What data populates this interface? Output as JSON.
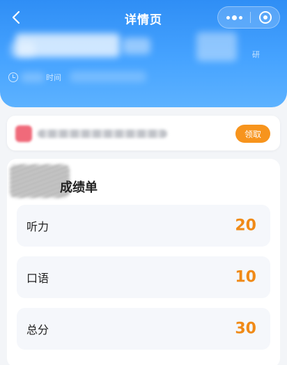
{
  "header": {
    "title": "详情页",
    "time_label": "时间",
    "small_tag": "研"
  },
  "coupon": {
    "claim_label": "领取"
  },
  "score_card": {
    "title": "成绩单",
    "rows": [
      {
        "label": "听力",
        "value": "20"
      },
      {
        "label": "口语",
        "value": "10"
      },
      {
        "label": "总分",
        "value": "30"
      }
    ]
  },
  "colors": {
    "header_blue": "#3b97f8",
    "accent_orange": "#f7941d",
    "score_orange": "#f08a17"
  },
  "icons": [
    "back-arrow-icon",
    "more-dots-icon",
    "target-icon",
    "clock-icon",
    "coupon-icon"
  ]
}
